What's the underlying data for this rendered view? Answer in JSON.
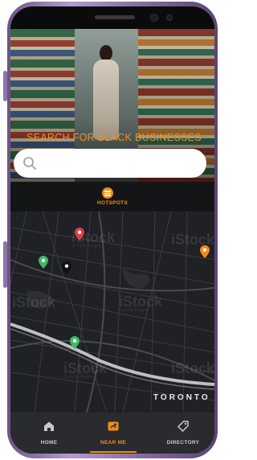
{
  "hero": {
    "title": "SEARCH FOR BLACK BUSINESSES",
    "search_placeholder": "",
    "search_value": ""
  },
  "hotspots": {
    "label": "HOTSPOTS",
    "icon": "list-icon"
  },
  "map": {
    "city_label": "TORONTO",
    "watermark": "iStock",
    "watermark_credit": "by Getty Images",
    "pins": [
      {
        "name": "pin-red",
        "color": "#e23b4a"
      },
      {
        "name": "pin-green-1",
        "color": "#3dbb6b"
      },
      {
        "name": "pin-black",
        "color": "#111111"
      },
      {
        "name": "pin-orange",
        "color": "#f28b13"
      },
      {
        "name": "pin-green-2",
        "color": "#3dbb6b"
      }
    ]
  },
  "tabbar": {
    "tabs": [
      {
        "label": "HOME",
        "icon": "home-icon",
        "active": false
      },
      {
        "label": "NEAR ME",
        "icon": "map-icon",
        "active": true
      },
      {
        "label": "DIRECTORY",
        "icon": "tag-icon",
        "active": false
      }
    ]
  },
  "colors": {
    "accent": "#f28b13",
    "tabbar_bg": "#2a2b2e",
    "map_bg": "#202124",
    "inactive_text": "#c9c9cc"
  }
}
